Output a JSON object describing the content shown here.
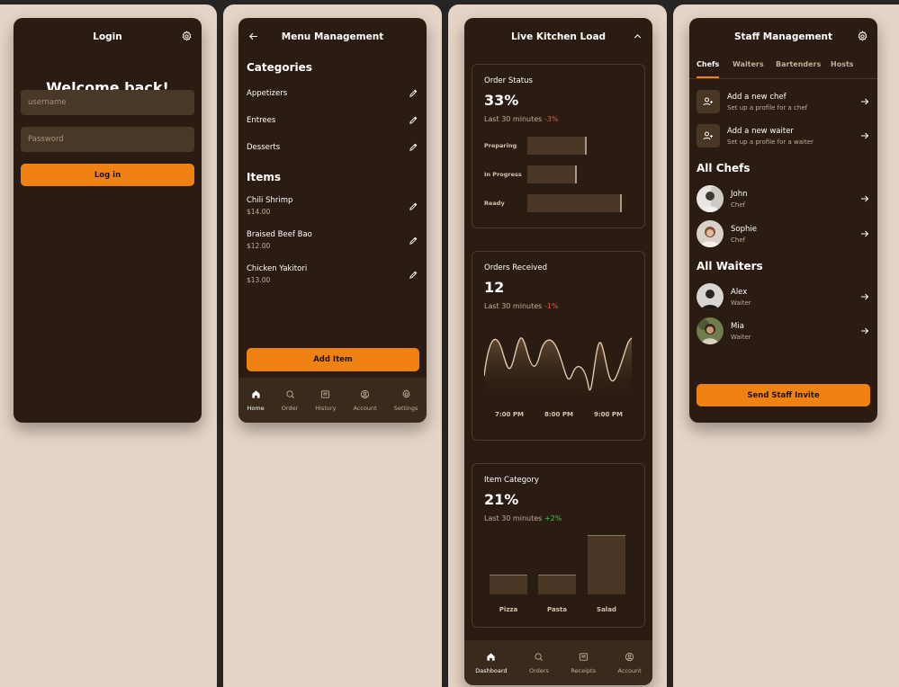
{
  "colors": {
    "accent": "#f08214",
    "card_bg": "#2a1c12",
    "panel_bg": "#e6d5c7",
    "negative": "#ff4a3a",
    "positive": "#2ed14a"
  },
  "login": {
    "title": "Login",
    "welcome": "Welcome back!",
    "username_placeholder": "username",
    "password_placeholder": "Password",
    "login_button": "Log in",
    "icons": {
      "settings": "gear-icon"
    }
  },
  "menu": {
    "title": "Menu Management",
    "categories_title": "Categories",
    "categories": [
      {
        "label": "Appetizers"
      },
      {
        "label": "Entrees"
      },
      {
        "label": "Desserts"
      }
    ],
    "items_title": "Items",
    "items": [
      {
        "name": "Chili Shrimp",
        "price": "$14.00"
      },
      {
        "name": "Braised Beef Bao",
        "price": "$12.00"
      },
      {
        "name": "Chicken Yakitori",
        "price": "$13.00"
      }
    ],
    "add_button": "Add Item",
    "tabs": [
      {
        "label": "Home",
        "icon": "home-icon",
        "active": true
      },
      {
        "label": "Order",
        "icon": "search-icon",
        "active": false
      },
      {
        "label": "History",
        "icon": "list-icon",
        "active": false
      },
      {
        "label": "Account",
        "icon": "user-icon",
        "active": false
      },
      {
        "label": "Settings",
        "icon": "gear-icon",
        "active": false
      }
    ]
  },
  "kitchen": {
    "title": "Live Kitchen Load",
    "order_status": {
      "title": "Order Status",
      "value": "33%",
      "subtitle": "Last 30 minutes",
      "delta": "-3%",
      "bars": [
        {
          "label": "Preparing",
          "value": 0.53
        },
        {
          "label": "In Progress",
          "value": 0.44
        },
        {
          "label": "Ready",
          "value": 0.84
        }
      ]
    },
    "orders_received": {
      "title": "Orders Received",
      "value": "12",
      "subtitle": "Last 30 minutes",
      "delta": "-1%",
      "x_labels": [
        "7:00 PM",
        "8:00 PM",
        "9:00 PM"
      ]
    },
    "item_category": {
      "title": "Item Category",
      "value": "21%",
      "subtitle": "Last 30 minutes",
      "delta": "+2%",
      "bars": [
        {
          "label": "Pizza",
          "value": 0.33
        },
        {
          "label": "Pasta",
          "value": 0.33
        },
        {
          "label": "Salad",
          "value": 1.0
        }
      ]
    },
    "tabs": [
      {
        "label": "Dashboard",
        "icon": "home-icon",
        "active": true
      },
      {
        "label": "Orders",
        "icon": "search-icon",
        "active": false
      },
      {
        "label": "Receipts",
        "icon": "list-icon",
        "active": false
      },
      {
        "label": "Account",
        "icon": "user-icon",
        "active": false
      }
    ]
  },
  "staff": {
    "title": "Staff Management",
    "tabs": [
      "Chefs",
      "Waiters",
      "Bartenders",
      "Hosts"
    ],
    "actions": [
      {
        "title": "Add a new chef",
        "subtitle": "Set up a profile for a chef"
      },
      {
        "title": "Add a new waiter",
        "subtitle": "Set up a profile for a waiter"
      }
    ],
    "chefs_title": "All Chefs",
    "chefs": [
      {
        "name": "John",
        "role": "Chef"
      },
      {
        "name": "Sophie",
        "role": "Chef"
      }
    ],
    "waiters_title": "All Waiters",
    "waiters": [
      {
        "name": "Alex",
        "role": "Waiter"
      },
      {
        "name": "Mia",
        "role": "Waiter"
      }
    ],
    "invite_button": "Send Staff Invite"
  }
}
